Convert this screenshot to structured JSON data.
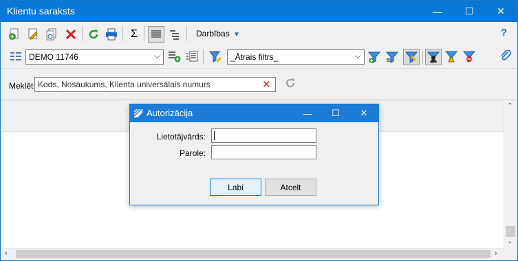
{
  "window": {
    "title": "Klientu saraksts",
    "minimize": "—",
    "maximize": "☐",
    "close": "✕"
  },
  "toolbar": {
    "actions_label": "Darbības",
    "help": "?"
  },
  "company_selector": {
    "value": "DEMO 11746"
  },
  "filter_selector": {
    "value": "_Ātrais filtrs_"
  },
  "search": {
    "label": "Meklēt",
    "placeholder": "Kods, Nosaukums, Klienta universālais numurs"
  },
  "dialog": {
    "title": "Autorizācija",
    "username_label": "Lietotājvārds:",
    "password_label": "Parole:",
    "ok_label": "Labi",
    "cancel_label": "Atcelt",
    "minimize": "—",
    "maximize": "☐",
    "close": "✕"
  },
  "colors": {
    "accent": "#0a78d7",
    "title_text": "#ffffff"
  }
}
